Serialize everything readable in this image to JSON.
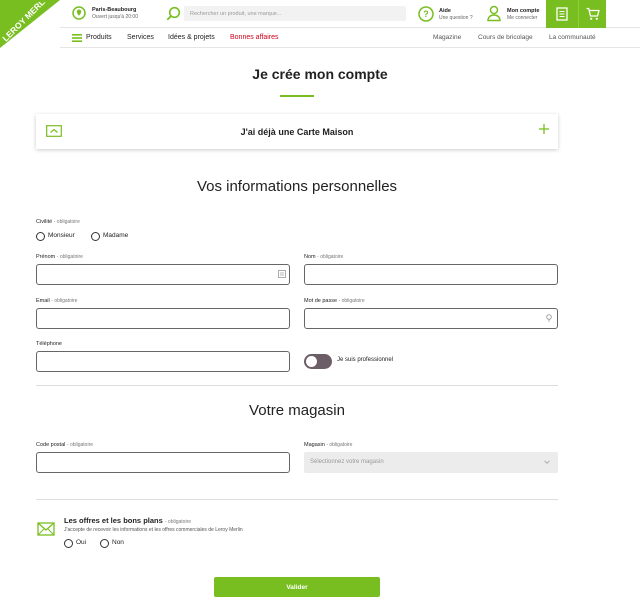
{
  "header": {
    "logo_text": "LEROY MERLIN",
    "store": {
      "name": "Paris-Beaubourg",
      "hours": "Ouvert jusqu'à 20:00"
    },
    "search": {
      "placeholder": "Rechercher un produit, une marque..."
    },
    "help": {
      "title": "Aide",
      "subtitle": "Une question ?"
    },
    "account": {
      "title": "Mon compte",
      "subtitle": "Me connecter"
    },
    "nav": [
      {
        "label": "Produits"
      },
      {
        "label": "Services"
      },
      {
        "label": "Idées & projets"
      },
      {
        "label": "Bonnes affaires"
      }
    ],
    "nav_right": [
      {
        "label": "Magazine"
      },
      {
        "label": "Cours de bricolage"
      },
      {
        "label": "La communauté"
      }
    ]
  },
  "page": {
    "title": "Je crée mon compte",
    "carte_maison": "J'ai déjà une Carte Maison"
  },
  "personal": {
    "title": "Vos informations personnelles",
    "civilite": {
      "label": "Civilité",
      "required": "- obligatoire",
      "options": [
        "Monsieur",
        "Madame"
      ]
    },
    "prenom": {
      "label": "Prénom",
      "required": "- obligatoire",
      "value": ""
    },
    "nom": {
      "label": "Nom",
      "required": "- obligatoire",
      "value": ""
    },
    "email": {
      "label": "Email",
      "required": "- obligatoire",
      "value": ""
    },
    "password": {
      "label": "Mot de passe",
      "required": "- obligatoire",
      "value": ""
    },
    "telephone": {
      "label": "Téléphone",
      "value": ""
    },
    "pro_toggle": "Je suis professionnel"
  },
  "store_section": {
    "title": "Votre magasin",
    "postal": {
      "label": "Code postal",
      "required": "- obligatoire",
      "value": ""
    },
    "magasin": {
      "label": "Magasin",
      "required": "- obligatoire",
      "placeholder": "Sélectionnez votre magasin"
    }
  },
  "offers": {
    "title": "Les offres et les bons plans",
    "required": "- obligatoire",
    "desc": "J'accepte de recevoir les informations et les offres commerciales de Leroy Merlin",
    "options": [
      "Oui",
      "Non"
    ]
  },
  "submit_label": "Valider",
  "colors": {
    "brand": "#78be20",
    "promo": "#d0021b",
    "toggle": "#6b5e66"
  }
}
